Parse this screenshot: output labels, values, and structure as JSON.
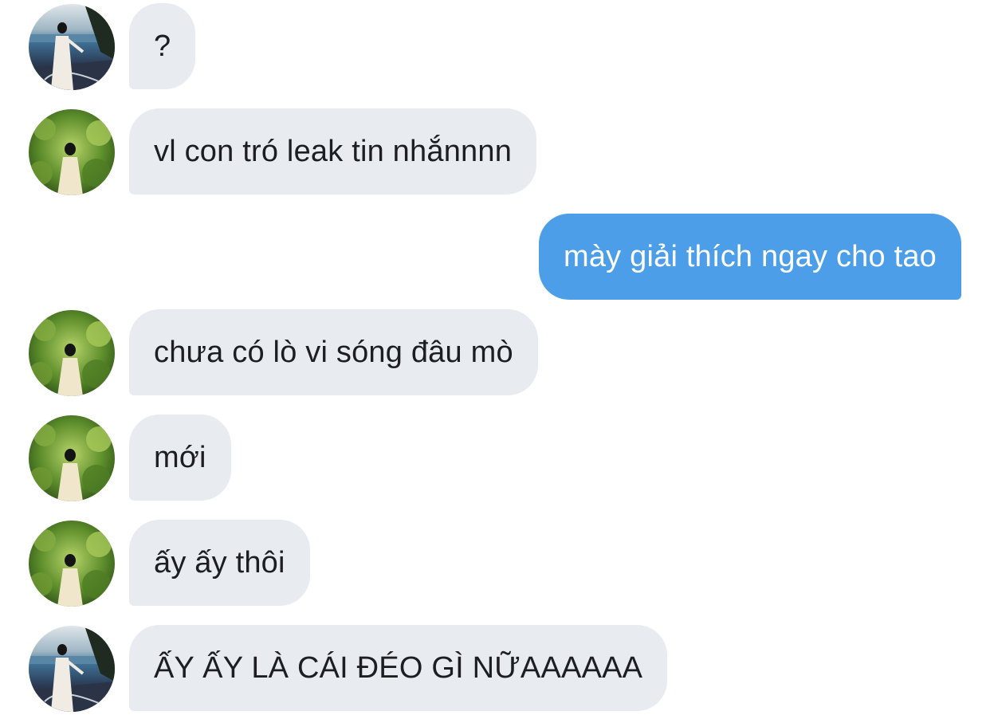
{
  "messages": [
    {
      "direction": "incoming",
      "text": "?",
      "avatar": "sea-photo"
    },
    {
      "direction": "incoming",
      "text": "vl con tró leak tin nhắnnnn",
      "avatar": "garden-photo"
    },
    {
      "direction": "outgoing",
      "text": "mày giải thích ngay cho tao"
    },
    {
      "direction": "incoming",
      "text": "chưa có lò vi sóng đâu mò",
      "avatar": "garden-photo"
    },
    {
      "direction": "incoming",
      "text": "mới",
      "avatar": "garden-photo"
    },
    {
      "direction": "incoming",
      "text": "ấy ấy thôi",
      "avatar": "garden-photo"
    },
    {
      "direction": "incoming",
      "text": "ẤY ẤY LÀ CÁI ĐÉO GÌ NỮAAAAAA",
      "avatar": "sea-photo"
    }
  ],
  "colors": {
    "incoming_bubble": "#e8ebf0",
    "outgoing_bubble": "#4c9ee8",
    "incoming_text": "#1c1e21",
    "outgoing_text": "#ffffff"
  }
}
